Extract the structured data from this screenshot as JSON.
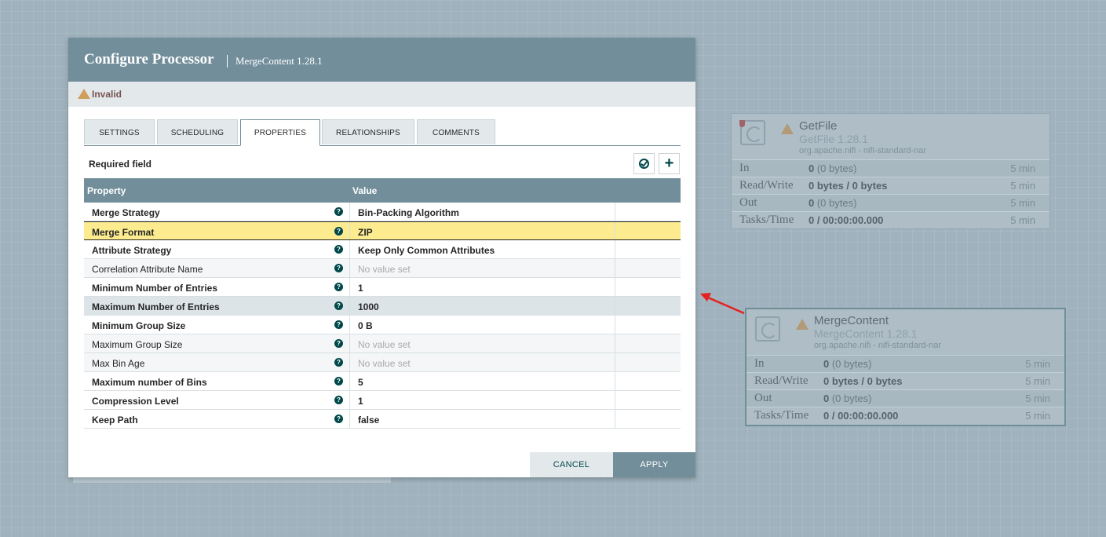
{
  "dialog": {
    "title": "Configure Processor",
    "subtitle": "MergeContent 1.28.1",
    "status": "Invalid",
    "tabs": [
      "SETTINGS",
      "SCHEDULING",
      "PROPERTIES",
      "RELATIONSHIPS",
      "COMMENTS"
    ],
    "active_tab": "PROPERTIES",
    "required_label": "Required field",
    "table_headers": {
      "property": "Property",
      "value": "Value"
    },
    "help_glyph": "?",
    "properties": [
      {
        "name": "Merge Strategy",
        "value": "Bin-Packing Algorithm",
        "required": true,
        "empty": false
      },
      {
        "name": "Merge Format",
        "value": "ZIP",
        "required": true,
        "empty": false
      },
      {
        "name": "Attribute Strategy",
        "value": "Keep Only Common Attributes",
        "required": true,
        "empty": false
      },
      {
        "name": "Correlation Attribute Name",
        "value": "No value set",
        "required": false,
        "empty": true
      },
      {
        "name": "Minimum Number of Entries",
        "value": "1",
        "required": true,
        "empty": false
      },
      {
        "name": "Maximum Number of Entries",
        "value": "1000",
        "required": true,
        "empty": false
      },
      {
        "name": "Minimum Group Size",
        "value": "0 B",
        "required": true,
        "empty": false
      },
      {
        "name": "Maximum Group Size",
        "value": "No value set",
        "required": false,
        "empty": true
      },
      {
        "name": "Max Bin Age",
        "value": "No value set",
        "required": false,
        "empty": true
      },
      {
        "name": "Maximum number of Bins",
        "value": "5",
        "required": true,
        "empty": false
      },
      {
        "name": "Compression Level",
        "value": "1",
        "required": true,
        "empty": false
      },
      {
        "name": "Keep Path",
        "value": "false",
        "required": true,
        "empty": false
      }
    ],
    "buttons": {
      "cancel": "CANCEL",
      "apply": "APPLY"
    }
  },
  "canvas": {
    "getfile": {
      "name": "GetFile",
      "type": "GetFile 1.28.1",
      "bundle": "org.apache.nifi - nifi-standard-nar",
      "stats": [
        {
          "label": "In",
          "value_bold": "0",
          "value_rest": " (0 bytes)",
          "time": "5 min"
        },
        {
          "label": "Read/Write",
          "value_bold": "0 bytes / 0 bytes",
          "value_rest": "",
          "time": "5 min"
        },
        {
          "label": "Out",
          "value_bold": "0",
          "value_rest": " (0 bytes)",
          "time": "5 min"
        },
        {
          "label": "Tasks/Time",
          "value_bold": "0 / 00:00:00.000",
          "value_rest": "",
          "time": "5 min"
        }
      ]
    },
    "mergecontent": {
      "name": "MergeContent",
      "type": "MergeContent 1.28.1",
      "bundle": "org.apache.nifi - nifi-standard-nar",
      "stats": [
        {
          "label": "In",
          "value_bold": "0",
          "value_rest": " (0 bytes)",
          "time": "5 min"
        },
        {
          "label": "Read/Write",
          "value_bold": "0 bytes / 0 bytes",
          "value_rest": "",
          "time": "5 min"
        },
        {
          "label": "Out",
          "value_bold": "0",
          "value_rest": " (0 bytes)",
          "time": "5 min"
        },
        {
          "label": "Tasks/Time",
          "value_bold": "0 / 00:00:00.000",
          "value_rest": "",
          "time": "5 min"
        }
      ]
    }
  },
  "colors": {
    "header": "#728e9b",
    "selected_row": "#fcec8f",
    "annotation_arrow": "#e52222",
    "warning": "#cf9f5d"
  }
}
